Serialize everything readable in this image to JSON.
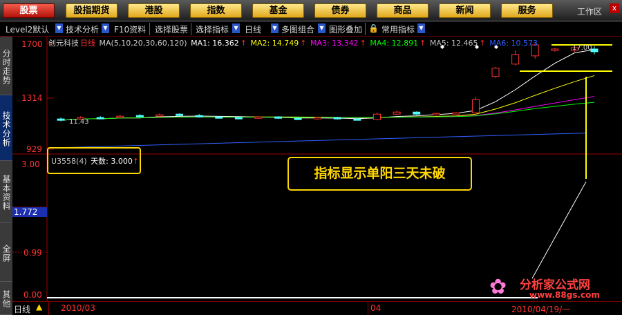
{
  "nav": {
    "buttons": [
      "股票",
      "股指期货",
      "港股",
      "指数",
      "基金",
      "债券",
      "商品",
      "新闻",
      "服务"
    ],
    "workspace": "工作区",
    "close": "x"
  },
  "toolbar": {
    "items": [
      "Level2默认",
      "技术分析",
      "F10资料",
      "选择股票",
      "选择指标",
      "日线",
      "多图组合",
      "图形叠加",
      "常用指标"
    ]
  },
  "sidetabs": [
    "分时走势",
    "技术分析",
    "基本资料",
    "全屏",
    "其他"
  ],
  "header": {
    "stock_name": "创元科技",
    "period": "日线",
    "ma_label": "MA(5,10,20,30,60,120)",
    "ma": [
      {
        "label": "MA1: 16.362",
        "color": "#ffffff"
      },
      {
        "label": "MA2: 14.749",
        "color": "#ffff00"
      },
      {
        "label": "MA3: 13.342",
        "color": "#ff00ff"
      },
      {
        "label": "MA4: 12.891",
        "color": "#00ff00"
      },
      {
        "label": "MA5: 12.465",
        "color": "#c0c0c0"
      },
      {
        "label": "MA6: 10.573",
        "color": "#3060ff"
      }
    ]
  },
  "price_axis": {
    "top": "1700",
    "mid": "1314",
    "bottom": "929",
    "marker_price": "1.772"
  },
  "indicator": {
    "name": "U3558(4)",
    "label": "天数:",
    "value": "3.000",
    "axis": [
      "3.00",
      "0.99",
      "0.00"
    ]
  },
  "annotation": "指标显示单阳三天未破",
  "price_labels": {
    "low": "11.43",
    "high": "17.00"
  },
  "bottom": {
    "period": "日线",
    "date1": "2010/03",
    "date2": "04",
    "date3": "2010/04/19/一"
  },
  "watermark": {
    "title": "分析家公式网",
    "url": "www.88gs.com"
  },
  "colors": {
    "up": "#ff3232",
    "down": "#54ffff",
    "annotation": "#ffff00",
    "frame": "#a00000"
  },
  "chart_data": {
    "type": "candlestick",
    "candles": [
      {
        "o": 11.6,
        "c": 11.5,
        "h": 11.7,
        "l": 11.43
      },
      {
        "o": 11.6,
        "c": 11.7,
        "h": 11.8,
        "l": 11.55
      },
      {
        "o": 11.7,
        "c": 11.65,
        "h": 11.8,
        "l": 11.6
      },
      {
        "o": 11.75,
        "c": 11.8,
        "h": 11.9,
        "l": 11.7
      },
      {
        "o": 11.85,
        "c": 11.75,
        "h": 11.95,
        "l": 11.7
      },
      {
        "o": 11.8,
        "c": 11.9,
        "h": 12.0,
        "l": 11.75
      },
      {
        "o": 11.95,
        "c": 11.85,
        "h": 12.0,
        "l": 11.8
      },
      {
        "o": 11.85,
        "c": 11.75,
        "h": 11.95,
        "l": 11.7
      },
      {
        "o": 11.75,
        "c": 11.7,
        "h": 11.8,
        "l": 11.65
      },
      {
        "o": 11.7,
        "c": 11.65,
        "h": 11.75,
        "l": 11.6
      },
      {
        "o": 11.65,
        "c": 11.75,
        "h": 11.8,
        "l": 11.6
      },
      {
        "o": 11.75,
        "c": 11.65,
        "h": 11.8,
        "l": 11.6
      },
      {
        "o": 11.65,
        "c": 11.6,
        "h": 11.7,
        "l": 11.55
      },
      {
        "o": 11.6,
        "c": 11.7,
        "h": 11.75,
        "l": 11.55
      },
      {
        "o": 11.7,
        "c": 11.6,
        "h": 11.75,
        "l": 11.55
      },
      {
        "o": 11.6,
        "c": 11.55,
        "h": 11.65,
        "l": 11.5
      },
      {
        "o": 11.55,
        "c": 11.95,
        "h": 12.05,
        "l": 11.5
      },
      {
        "o": 11.95,
        "c": 12.1,
        "h": 12.2,
        "l": 11.9
      },
      {
        "o": 12.1,
        "c": 11.95,
        "h": 12.15,
        "l": 11.9
      },
      {
        "o": 11.95,
        "c": 12.0,
        "h": 12.05,
        "l": 11.85
      },
      {
        "o": 12.0,
        "c": 12.05,
        "h": 12.1,
        "l": 11.95
      },
      {
        "o": 12.05,
        "c": 13.0,
        "h": 13.2,
        "l": 12.0
      },
      {
        "o": 14.7,
        "c": 15.3,
        "h": 15.4,
        "l": 14.6
      },
      {
        "o": 15.6,
        "c": 16.3,
        "h": 16.6,
        "l": 15.5
      },
      {
        "o": 16.2,
        "c": 17.0,
        "h": 17.1,
        "l": 16.0
      },
      {
        "o": 16.6,
        "c": 16.7,
        "h": 16.8,
        "l": 16.5
      },
      {
        "o": 16.6,
        "c": 16.8,
        "h": 16.9,
        "l": 16.5
      },
      {
        "o": 16.7,
        "c": 16.5,
        "h": 16.9,
        "l": 16.3
      }
    ],
    "ylim": [
      9.29,
      17.0
    ],
    "indicator_ylim": [
      0,
      3.0
    ]
  }
}
